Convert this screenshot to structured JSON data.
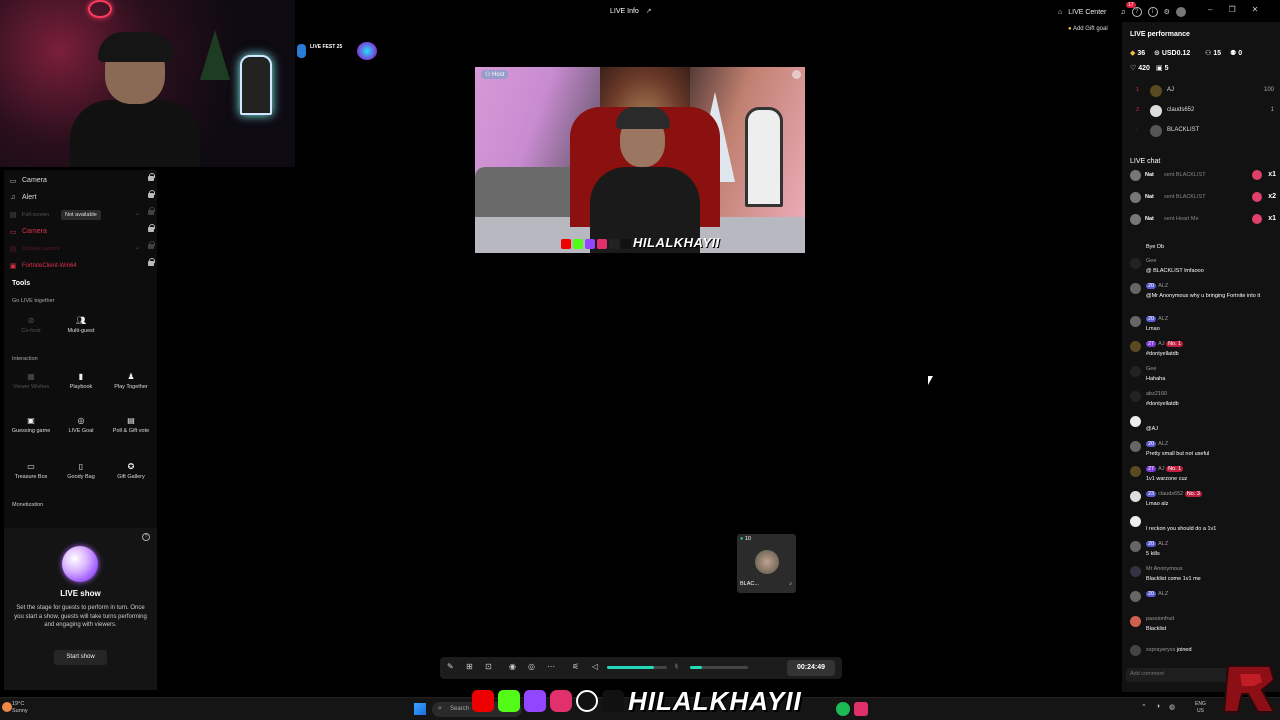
{
  "top": {
    "live_info": "LIVE Info",
    "live_center": "LIVE Center",
    "notif_count": "17",
    "add_gift_goal": "Add Gift goal"
  },
  "fest_badge": "LIVE FEST 25",
  "sources": [
    {
      "label": "Camera",
      "state": "normal"
    },
    {
      "label": "Alert",
      "state": "normal"
    },
    {
      "label": "Full-screen",
      "state": "disabled"
    },
    {
      "label": "Camera",
      "state": "error"
    },
    {
      "label": "Display capture",
      "state": "error-dim"
    },
    {
      "label": "FortniteClient-Win64",
      "state": "error"
    }
  ],
  "tooltip": "Not available",
  "tools": {
    "title": "Tools",
    "go_live_together": "Go LIVE together",
    "interaction": "Interaction",
    "monetization": "Monetization",
    "cohost": "Co-host",
    "multiguest": "Multi-guest",
    "viewer_wishes": "Viewer Wishes",
    "playbook": "Playbook",
    "play_together": "Play Together",
    "guessing_game": "Guessing game",
    "live_goal": "LIVE Goal",
    "poll_gift_vote": "Poll & Gift vote",
    "treasure_box": "Treasure Box",
    "goody_bag": "Goody Bag",
    "gift_gallery": "Gift Gallery"
  },
  "live_show": {
    "title": "LIVE show",
    "description": "Set the stage for guests to perform in turn. Once you start a show, guests will take turns performing and engaging with viewers.",
    "button": "Start show"
  },
  "stream": {
    "host_badge": "Host",
    "name_overlay": "HILALKHAYII"
  },
  "guest": {
    "count": "10",
    "name": "BLAC..."
  },
  "controls": {
    "timer": "00:24:49",
    "volume_level": 0.78,
    "mic_level": 0.2
  },
  "performance": {
    "title": "LIVE performance",
    "stats_row1": [
      "36",
      "USD0.12",
      "15",
      "0"
    ],
    "stats_row2": [
      "420",
      "5"
    ],
    "ranking": [
      {
        "rank": "1",
        "name": "AJ",
        "score": "100"
      },
      {
        "rank": "2",
        "name": "clauds652",
        "score": "1"
      },
      {
        "rank": "-",
        "name": "BLACKLIST",
        "score": ""
      }
    ]
  },
  "chat": {
    "title": "LIVE chat",
    "gifts": [
      {
        "who": "Nat",
        "what": "sent BLACKLIST",
        "count": "x1"
      },
      {
        "who": "Nat",
        "what": "sent BLACKLIST",
        "count": "x2"
      },
      {
        "who": "Nat",
        "what": "sent Heart Me",
        "count": "x1"
      }
    ],
    "messages": [
      {
        "user": "",
        "level": "",
        "text": "Bye Db"
      },
      {
        "user": "Gee",
        "level": "",
        "text": "@ BLACKLIST lmfaooo"
      },
      {
        "user": "ALZ",
        "level": "20",
        "text": "@Mr Anonymous why u bringing Fortnite into it"
      },
      {
        "user": "ALZ",
        "level": "20",
        "text": "Lmao"
      },
      {
        "user": "AJ",
        "level": "27",
        "text": "#dontyellatdb",
        "tag": "No. 1"
      },
      {
        "user": "Gee",
        "level": "",
        "text": "Hahaha"
      },
      {
        "user": "abz2160",
        "level": "",
        "text": "#dontyellatdb"
      },
      {
        "user": "",
        "level": "",
        "text": "@AJ"
      },
      {
        "user": "ALZ",
        "level": "20",
        "text": "Pretty small but not useful"
      },
      {
        "user": "AJ",
        "level": "27",
        "text": "1v1 warzone cuz",
        "tag": "No. 1"
      },
      {
        "user": "clauds652",
        "level": "23",
        "text": "Lmao alz",
        "tag": "No. 3"
      },
      {
        "user": "",
        "level": "",
        "text": "I reckon you should do a 1v1"
      },
      {
        "user": "ALZ",
        "level": "20",
        "text": "5 kills"
      },
      {
        "user": "Mr Anonymous",
        "level": "",
        "text": "Blacklist come 1v1 me"
      },
      {
        "user": "ALZ",
        "level": "20",
        "text": ""
      },
      {
        "user": "passionfruit",
        "level": "",
        "text": "Blacklist"
      }
    ],
    "joined_user": "xxprayeryxx",
    "joined_text": "joined",
    "add_comment_placeholder": "Add comment"
  },
  "taskbar": {
    "temp": "19°C",
    "weather": "Sunny",
    "search": "Search",
    "lang1": "ENG",
    "lang2": "US"
  }
}
